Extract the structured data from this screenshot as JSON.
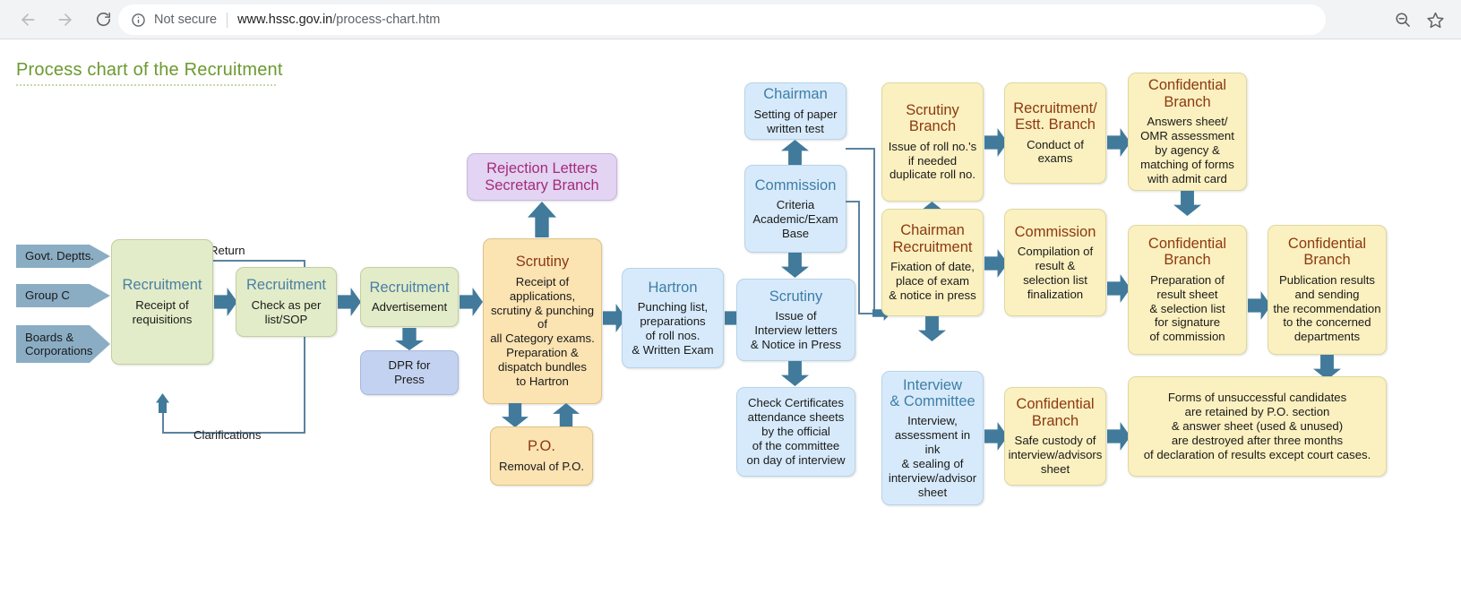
{
  "browser": {
    "back_icon": "back-arrow-icon",
    "forward_icon": "forward-arrow-icon",
    "reload_icon": "reload-icon",
    "info_icon": "info-circle-icon",
    "security_label": "Not secure",
    "url_host": "www.hssc.gov.in",
    "url_path": "/process-chart.htm",
    "zoom_out_icon": "zoom-out-icon",
    "bookmark_icon": "star-bookmark-icon"
  },
  "page": {
    "title": "Process chart of the Recruitment"
  },
  "colors": {
    "title_green": "#6b9a2f",
    "arrow_blue": "#417a9b",
    "input_arrow": "#8aadc4",
    "green_box": "#e3ecc8",
    "blue_box": "#d7eafb",
    "yellow_box": "#fbf0bf",
    "orange_box": "#fbe3b2",
    "purple_box": "#e2d4f2",
    "connector_line": "#5b83a0"
  },
  "chart_data": {
    "type": "diagram",
    "title": "Process chart of the Recruitment",
    "inputs": [
      {
        "label": "Govt. Deptts."
      },
      {
        "label": "Group C"
      },
      {
        "label": "Boards &\nCorporations"
      }
    ],
    "labels": [
      {
        "text": "Return"
      },
      {
        "text": "Clarifications"
      }
    ],
    "nodes": [
      {
        "id": "recruitment-receipt",
        "header": "Recruitment",
        "body": "Receipt of\nrequisitions"
      },
      {
        "id": "recruitment-check",
        "header": "Recruitment",
        "body": "Check as per\nlist/SOP"
      },
      {
        "id": "recruitment-adv",
        "header": "Recruitment",
        "body": "Advertisement"
      },
      {
        "id": "dpr-press",
        "header": "",
        "body": "DPR for\nPress"
      },
      {
        "id": "rejection-letters",
        "header": "Rejection Letters\nSecretary Branch",
        "body": ""
      },
      {
        "id": "scrutiny-main",
        "header": "Scrutiny",
        "body": "Receipt of\napplications,\nscrutiny & punching\nof\nall Category exams.\nPreparation &\ndispatch bundles\nto Hartron"
      },
      {
        "id": "po-removal",
        "header": "P.O.",
        "body": "Removal of P.O."
      },
      {
        "id": "hartron",
        "header": "Hartron",
        "body": "Punching list,\npreparations\nof roll nos.\n& Written Exam"
      },
      {
        "id": "chairman-paper",
        "header": "Chairman",
        "body": "Setting of paper\nwritten test"
      },
      {
        "id": "commission-criteria",
        "header": "Commission",
        "body": "Criteria\nAcademic/Exam\nBase"
      },
      {
        "id": "scrutiny-interview",
        "header": "Scrutiny",
        "body": "Issue of\nInterview letters\n& Notice in Press"
      },
      {
        "id": "check-certificates",
        "header": "",
        "body": "Check Certificates\nattendance sheets\nby the official\nof the committee\non day of interview"
      },
      {
        "id": "scrutiny-branch",
        "header": "Scrutiny\nBranch",
        "body": "Issue of roll no.'s\nif needed\nduplicate roll no."
      },
      {
        "id": "chairman-recruitment",
        "header": "Chairman\nRecruitment",
        "body": "Fixation of date,\nplace of exam\n& notice in press"
      },
      {
        "id": "interview-committee",
        "header": "Interview\n& Committee",
        "body": "Interview,\nassessment in ink\n& sealing of\ninterview/advisor\nsheet"
      },
      {
        "id": "recruitment-estt",
        "header": "Recruitment/\nEstt. Branch",
        "body": "Conduct of exams"
      },
      {
        "id": "commission-result",
        "header": "Commission",
        "body": "Compilation of\nresult &\nselection list\nfinalization"
      },
      {
        "id": "confidential-safe",
        "header": "Confidential\nBranch",
        "body": "Safe custody of\ninterview/advisors\nsheet"
      },
      {
        "id": "confidential-omr",
        "header": "Confidential\nBranch",
        "body": "Answers sheet/\nOMR assessment\nby agency &\nmatching of forms\nwith admit card"
      },
      {
        "id": "confidential-result",
        "header": "Confidential\nBranch",
        "body": "Preparation of\nresult sheet\n& selection list\nfor signature\nof commission"
      },
      {
        "id": "confidential-publish",
        "header": "Confidential\nBranch",
        "body": "Publication results\nand sending\nthe recommendation\nto the concerned\ndepartments"
      },
      {
        "id": "forms-destroy",
        "header": "",
        "body": "Forms of unsuccessful candidates\nare retained by P.O. section\n& answer sheet (used & unused)\nare destroyed after three months\nof declaration of results except court cases."
      }
    ]
  }
}
